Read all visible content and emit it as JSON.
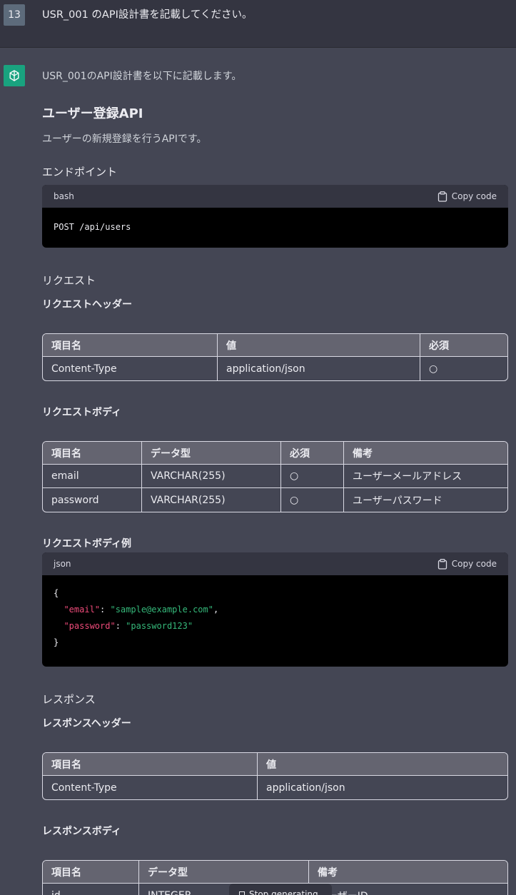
{
  "user_message": {
    "number": "13",
    "text": "USR_001 のAPI設計書を記載してください。"
  },
  "response": {
    "intro": "USR_001のAPI設計書を以下に記載します。",
    "title": "ユーザー登録API",
    "description": "ユーザーの新規登録を行うAPIです。",
    "endpoint_heading": "エンドポイント",
    "endpoint_code": {
      "lang": "bash",
      "copy_label": "Copy code",
      "code": "POST /api/users"
    },
    "request_heading": "リクエスト",
    "request_headers_heading": "リクエストヘッダー",
    "request_headers_table": {
      "headers": [
        "項目名",
        "値",
        "必須"
      ],
      "rows": [
        [
          "Content-Type",
          "application/json",
          "○"
        ]
      ]
    },
    "request_body_heading": "リクエストボディ",
    "request_body_table": {
      "headers": [
        "項目名",
        "データ型",
        "必須",
        "備考"
      ],
      "rows": [
        [
          "email",
          "VARCHAR(255)",
          "○",
          "ユーザーメールアドレス"
        ],
        [
          "password",
          "VARCHAR(255)",
          "○",
          "ユーザーパスワード"
        ]
      ]
    },
    "request_body_example_heading": "リクエストボディ例",
    "json_code": {
      "lang": "json",
      "copy_label": "Copy code",
      "open": "{",
      "key1": "\"email\"",
      "val1": "\"sample@example.com\"",
      "key2": "\"password\"",
      "val2": "\"password123\"",
      "close": "}"
    },
    "response_heading": "レスポンス",
    "response_headers_heading": "レスポンスヘッダー",
    "response_headers_table": {
      "headers": [
        "項目名",
        "値"
      ],
      "rows": [
        [
          "Content-Type",
          "application/json"
        ]
      ]
    },
    "response_body_heading": "レスポンスボディ",
    "response_body_table": {
      "headers": [
        "項目名",
        "データ型",
        "備考"
      ],
      "rows": [
        [
          "id",
          "INTEGER",
          "ユーザーID"
        ]
      ]
    }
  },
  "bottom_popup": {
    "label": "Stop generating"
  }
}
